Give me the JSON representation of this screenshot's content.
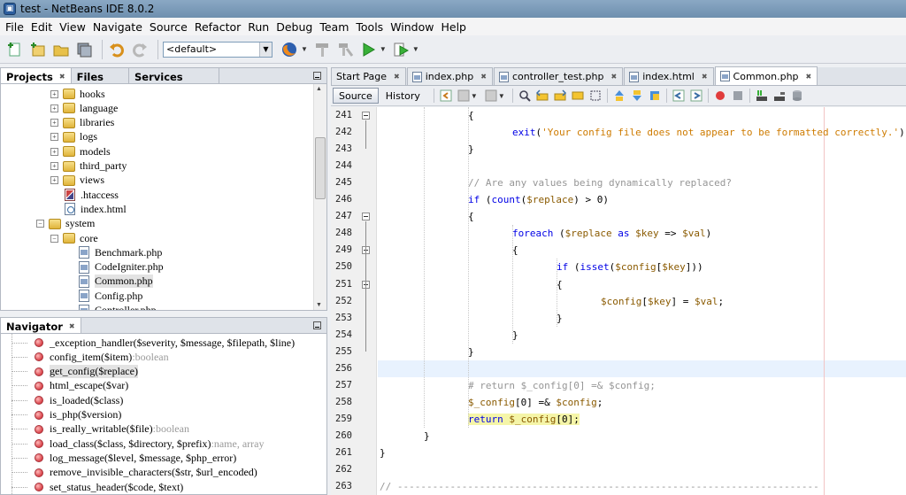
{
  "window": {
    "title": "test - NetBeans IDE 8.0.2"
  },
  "menu": [
    "File",
    "Edit",
    "View",
    "Navigate",
    "Source",
    "Refactor",
    "Run",
    "Debug",
    "Team",
    "Tools",
    "Window",
    "Help"
  ],
  "toolbar": {
    "config_value": "<default>"
  },
  "projects_panel": {
    "tabs": [
      "Projects",
      "Files",
      "Services"
    ],
    "tree": [
      {
        "label": "hooks",
        "type": "folder",
        "depth": 3,
        "expander": "+"
      },
      {
        "label": "language",
        "type": "folder",
        "depth": 3,
        "expander": "+"
      },
      {
        "label": "libraries",
        "type": "folder",
        "depth": 3,
        "expander": "+"
      },
      {
        "label": "logs",
        "type": "folder",
        "depth": 3,
        "expander": "+"
      },
      {
        "label": "models",
        "type": "folder",
        "depth": 3,
        "expander": "+"
      },
      {
        "label": "third_party",
        "type": "folder",
        "depth": 3,
        "expander": "+"
      },
      {
        "label": "views",
        "type": "folder",
        "depth": 3,
        "expander": "+"
      },
      {
        "label": ".htaccess",
        "type": "hta",
        "depth": 3
      },
      {
        "label": "index.html",
        "type": "html",
        "depth": 3
      },
      {
        "label": "system",
        "type": "folder",
        "depth": 2,
        "expander": "−"
      },
      {
        "label": "core",
        "type": "folder",
        "depth": 3,
        "expander": "−"
      },
      {
        "label": "Benchmark.php",
        "type": "php",
        "depth": 4
      },
      {
        "label": "CodeIgniter.php",
        "type": "php",
        "depth": 4
      },
      {
        "label": "Common.php",
        "type": "php",
        "depth": 4,
        "selected": true
      },
      {
        "label": "Config.php",
        "type": "php",
        "depth": 4
      },
      {
        "label": "Controller.php",
        "type": "php",
        "depth": 4
      }
    ]
  },
  "navigator": {
    "title": "Navigator",
    "items": [
      {
        "name": "_exception_handler($severity, $message, $filepath, $line)",
        "rtype": ""
      },
      {
        "name": "config_item($item)",
        "rtype": ":boolean"
      },
      {
        "name": "get_config($replace)",
        "rtype": "",
        "selected": true
      },
      {
        "name": "html_escape($var)",
        "rtype": ""
      },
      {
        "name": "is_loaded($class)",
        "rtype": ""
      },
      {
        "name": "is_php($version)",
        "rtype": ""
      },
      {
        "name": "is_really_writable($file)",
        "rtype": ":boolean"
      },
      {
        "name": "load_class($class, $directory, $prefix)",
        "rtype": ":name, array"
      },
      {
        "name": "log_message($level, $message, $php_error)",
        "rtype": ""
      },
      {
        "name": "remove_invisible_characters($str, $url_encoded)",
        "rtype": ""
      },
      {
        "name": "set_status_header($code, $text)",
        "rtype": ""
      }
    ]
  },
  "editor": {
    "tabs": [
      {
        "label": "Start Page",
        "icon": false
      },
      {
        "label": "index.php",
        "icon": true
      },
      {
        "label": "controller_test.php",
        "icon": true
      },
      {
        "label": "index.html",
        "icon": true
      },
      {
        "label": "Common.php",
        "icon": true,
        "active": true
      }
    ],
    "source_label": "Source",
    "history_label": "History",
    "current_line": 256,
    "lines": [
      {
        "n": 241,
        "indent": 0,
        "fold": true,
        "tokens": [
          [
            "plain",
            "{"
          ]
        ]
      },
      {
        "n": 242,
        "indent": 1,
        "tokens": [
          [
            "kw",
            "exit"
          ],
          [
            "plain",
            "("
          ],
          [
            "str",
            "'Your config file does not appear to be formatted correctly.'"
          ],
          [
            "plain",
            ");"
          ]
        ]
      },
      {
        "n": 243,
        "indent": 0,
        "tokens": [
          [
            "plain",
            "}"
          ]
        ]
      },
      {
        "n": 244,
        "indent": 0,
        "tokens": []
      },
      {
        "n": 245,
        "indent": 0,
        "tokens": [
          [
            "cmt",
            "// Are any values being dynamically replaced?"
          ]
        ]
      },
      {
        "n": 246,
        "indent": 0,
        "tokens": [
          [
            "kw",
            "if"
          ],
          [
            "plain",
            " ("
          ],
          [
            "kw",
            "count"
          ],
          [
            "plain",
            "("
          ],
          [
            "var",
            "$replace"
          ],
          [
            "plain",
            ") > "
          ],
          [
            "num",
            "0"
          ],
          [
            "plain",
            ")"
          ]
        ]
      },
      {
        "n": 247,
        "indent": 0,
        "fold": true,
        "tokens": [
          [
            "plain",
            "{"
          ]
        ]
      },
      {
        "n": 248,
        "indent": 1,
        "tokens": [
          [
            "kw",
            "foreach"
          ],
          [
            "plain",
            " ("
          ],
          [
            "var",
            "$replace"
          ],
          [
            "plain",
            " "
          ],
          [
            "kw",
            "as"
          ],
          [
            "plain",
            " "
          ],
          [
            "var",
            "$key"
          ],
          [
            "plain",
            " => "
          ],
          [
            "var",
            "$val"
          ],
          [
            "plain",
            ")"
          ]
        ]
      },
      {
        "n": 249,
        "indent": 1,
        "fold": true,
        "tokens": [
          [
            "plain",
            "{"
          ]
        ]
      },
      {
        "n": 250,
        "indent": 2,
        "tokens": [
          [
            "kw",
            "if"
          ],
          [
            "plain",
            " ("
          ],
          [
            "kw",
            "isset"
          ],
          [
            "plain",
            "("
          ],
          [
            "var",
            "$config"
          ],
          [
            "plain",
            "["
          ],
          [
            "var",
            "$key"
          ],
          [
            "plain",
            "]))"
          ]
        ]
      },
      {
        "n": 251,
        "indent": 2,
        "fold": true,
        "tokens": [
          [
            "plain",
            "{"
          ]
        ]
      },
      {
        "n": 252,
        "indent": 3,
        "tokens": [
          [
            "var",
            "$config"
          ],
          [
            "plain",
            "["
          ],
          [
            "var",
            "$key"
          ],
          [
            "plain",
            "] = "
          ],
          [
            "var",
            "$val"
          ],
          [
            "plain",
            ";"
          ]
        ]
      },
      {
        "n": 253,
        "indent": 2,
        "tokens": [
          [
            "plain",
            "}"
          ]
        ]
      },
      {
        "n": 254,
        "indent": 1,
        "tokens": [
          [
            "plain",
            "}"
          ]
        ]
      },
      {
        "n": 255,
        "indent": 0,
        "tokens": [
          [
            "plain",
            "}"
          ]
        ]
      },
      {
        "n": 256,
        "indent": 0,
        "tokens": []
      },
      {
        "n": 257,
        "indent": 0,
        "tokens": [
          [
            "cmt",
            "# return $_config[0] =& $config;"
          ]
        ]
      },
      {
        "n": 258,
        "indent": 0,
        "tokens": [
          [
            "var",
            "$_config"
          ],
          [
            "plain",
            "["
          ],
          [
            "num",
            "0"
          ],
          [
            "plain",
            "] =& "
          ],
          [
            "var",
            "$config"
          ],
          [
            "plain",
            ";"
          ]
        ]
      },
      {
        "n": 259,
        "indent": 0,
        "hl": true,
        "tokens": [
          [
            "kw",
            "return"
          ],
          [
            "plain",
            " "
          ],
          [
            "var",
            "$_config"
          ],
          [
            "plain",
            "["
          ],
          [
            "num",
            "0"
          ],
          [
            "plain",
            "];"
          ]
        ]
      },
      {
        "n": 260,
        "indent": -1,
        "tokens": [
          [
            "plain",
            "}"
          ]
        ]
      },
      {
        "n": 261,
        "indent": -2,
        "tokens": [
          [
            "plain",
            "}"
          ]
        ]
      },
      {
        "n": 262,
        "indent": -2,
        "tokens": []
      },
      {
        "n": 263,
        "indent": -2,
        "tokens": [
          [
            "cmt",
            "// ------------------------------------------------------------------------"
          ]
        ]
      }
    ]
  },
  "colors": {
    "keyword": "#0000e6",
    "variable": "#8a5a00",
    "string": "#ce7b00",
    "comment": "#969696",
    "current_line": "#e8f2fe",
    "highlight": "#f5f5a8"
  }
}
